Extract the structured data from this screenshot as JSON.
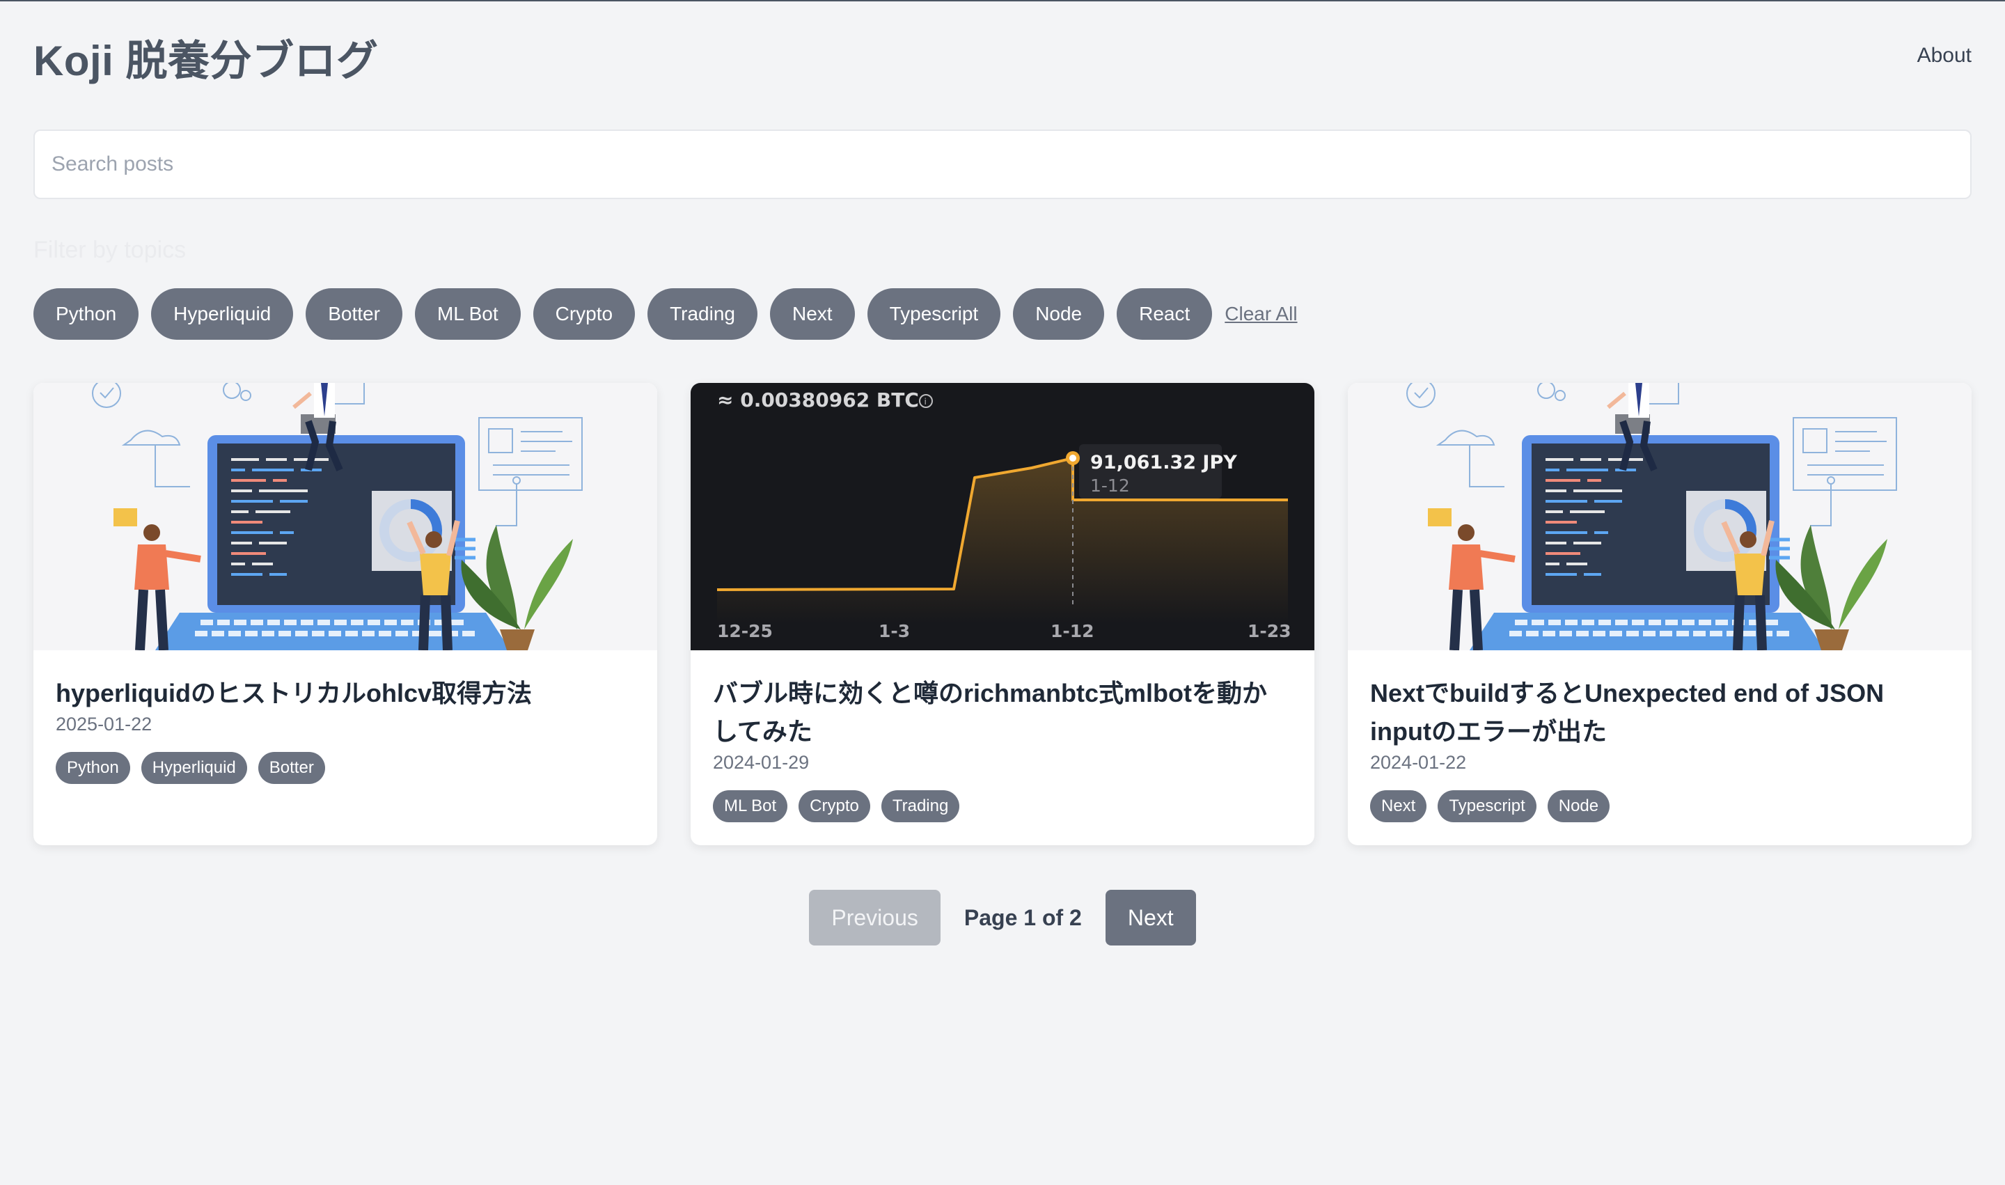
{
  "header": {
    "title": "Koji 脱養分ブログ",
    "about_label": "About"
  },
  "search": {
    "placeholder": "Search posts",
    "value": ""
  },
  "filters": {
    "label": "Filter by topics",
    "topics": [
      "Python",
      "Hyperliquid",
      "Botter",
      "ML Bot",
      "Crypto",
      "Trading",
      "Next",
      "Typescript",
      "Node",
      "React"
    ],
    "clear_label": "Clear All"
  },
  "posts": [
    {
      "title": "hyperliquidのヒストリカルohlcv取得方法",
      "date": "2025-01-22",
      "tags": [
        "Python",
        "Hyperliquid",
        "Botter"
      ],
      "thumbnail": "laptop-developers-illustration"
    },
    {
      "title": "バブル時に効くと噂のrichmanbtc式mlbotを動かしてみた",
      "date": "2024-01-29",
      "tags": [
        "ML Bot",
        "Crypto",
        "Trading"
      ],
      "thumbnail": "btc-price-chart",
      "chart": {
        "balance": "≈ 0.00380962 BTC",
        "tooltip_value": "91,061.32 JPY",
        "tooltip_date": "1-12",
        "x_labels": [
          "12-25",
          "1-3",
          "1-12",
          "1-23"
        ],
        "line_color": "#f0a830",
        "background": "#17181c"
      }
    },
    {
      "title": "NextでbuildするとUnexpected end of JSON inputのエラーが出た",
      "date": "2024-01-22",
      "tags": [
        "Next",
        "Typescript",
        "Node"
      ],
      "thumbnail": "laptop-developers-illustration"
    }
  ],
  "pagination": {
    "prev_label": "Previous",
    "info": "Page 1 of 2",
    "next_label": "Next",
    "current": 1,
    "total": 2
  }
}
